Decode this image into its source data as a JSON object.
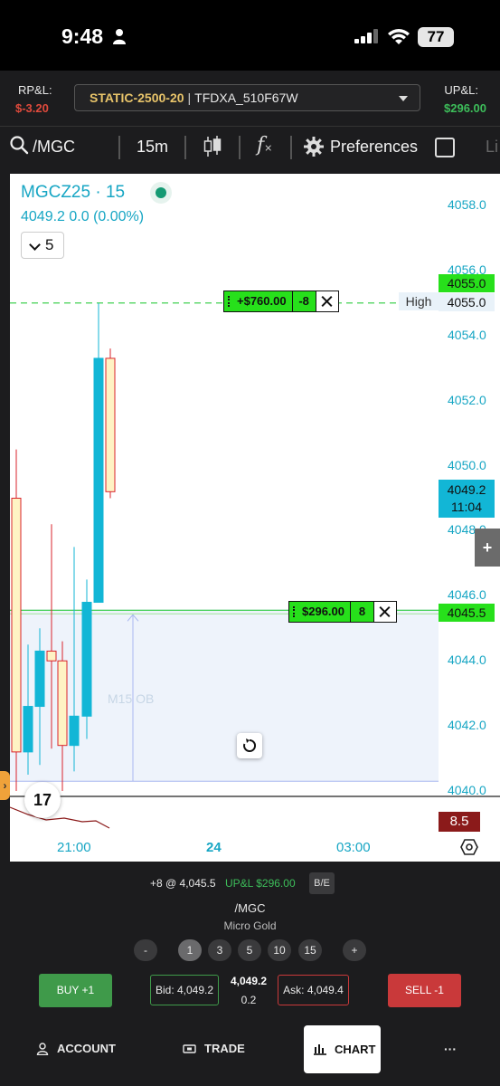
{
  "status_bar": {
    "time": "9:48",
    "battery": "77"
  },
  "account_bar": {
    "rpl_label": "RP&L:",
    "rpl_value": "$-3.20",
    "upl_label": "UP&L:",
    "upl_value": "$296.00",
    "account_name": "STATIC-2500-20",
    "separator": "|",
    "account_id": "TFDXA_510F67W"
  },
  "toolbar": {
    "symbol": "/MGC",
    "interval": "15m",
    "indicator_glyph": "f",
    "preferences_label": "Preferences",
    "trailing_label": "Li"
  },
  "chart": {
    "symbol_title": "MGCZ25 · 15",
    "quote": "4049.2  0.0 (0.00%)",
    "collapse_count": "5",
    "high_label": "High",
    "high_price_tag": "4055.0",
    "high_price_tag2": "4055.0",
    "position_price_tag": "4045.5",
    "current_price": "4049.2",
    "countdown": "11:04",
    "ob_label": "M15 OB",
    "indicator_value": "8.5",
    "logo_text": "17",
    "plus_label": "+",
    "handle_glyph": "›",
    "axis_labels": [
      "4058.0",
      "4056.0",
      "4054.0",
      "4052.0",
      "4050.0",
      "4048.0",
      "4046.0",
      "4044.0",
      "4042.0",
      "4040.0"
    ],
    "time_labels": [
      "21:00",
      "24",
      "03:00"
    ],
    "orders": [
      {
        "pnl": "+$760.00",
        "qty": "-8"
      },
      {
        "pnl": "$296.00",
        "qty": "8"
      }
    ],
    "colors": {
      "up": "#12b6d6",
      "down_fill": "#fff3c4",
      "down_border": "#d9232b",
      "grid_green": "#2ecc40",
      "zone": "#eef3fb"
    }
  },
  "chart_data": {
    "type": "candlestick",
    "title": "MGCZ25 · 15",
    "ylim": [
      4040.0,
      4058.0
    ],
    "candles": [
      {
        "open": 4049.0,
        "high": 4050.5,
        "low": 4040.0,
        "close": 4041.2
      },
      {
        "open": 4041.2,
        "high": 4044.5,
        "low": 4040.5,
        "close": 4042.6
      },
      {
        "open": 4042.6,
        "high": 4045.0,
        "low": 4040.8,
        "close": 4044.3
      },
      {
        "open": 4044.3,
        "high": 4048.2,
        "low": 4041.3,
        "close": 4044.0
      },
      {
        "open": 4044.0,
        "high": 4044.6,
        "low": 4040.0,
        "close": 4041.4
      },
      {
        "open": 4041.4,
        "high": 4047.5,
        "low": 4040.6,
        "close": 4042.3
      },
      {
        "open": 4042.3,
        "high": 4046.5,
        "low": 4041.6,
        "close": 4045.8
      },
      {
        "open": 4045.8,
        "high": 4055.0,
        "low": 4045.8,
        "close": 4053.3
      },
      {
        "open": 4053.3,
        "high": 4053.6,
        "low": 4049.0,
        "close": 4049.2
      }
    ],
    "high_line": 4055.0,
    "position_line": 4045.5,
    "x_labels": [
      "21:00",
      "24",
      "03:00"
    ]
  },
  "trade_panel": {
    "position_text": "+8 @ 4,045.5",
    "upl_text": "UP&L $296.00",
    "be_label": "B/E",
    "symbol": "/MGC",
    "description": "Micro Gold",
    "quantities": [
      "-",
      "1",
      "3",
      "5",
      "10",
      "15",
      "+"
    ],
    "buy_label": "BUY +1",
    "sell_label": "SELL -1",
    "bid": "Bid: 4,049.2",
    "ask": "Ask: 4,049.4",
    "last": "4,049.2",
    "change": "0.2"
  },
  "nav": {
    "account": "ACCOUNT",
    "trade": "TRADE",
    "chart": "CHART",
    "more": "···"
  }
}
